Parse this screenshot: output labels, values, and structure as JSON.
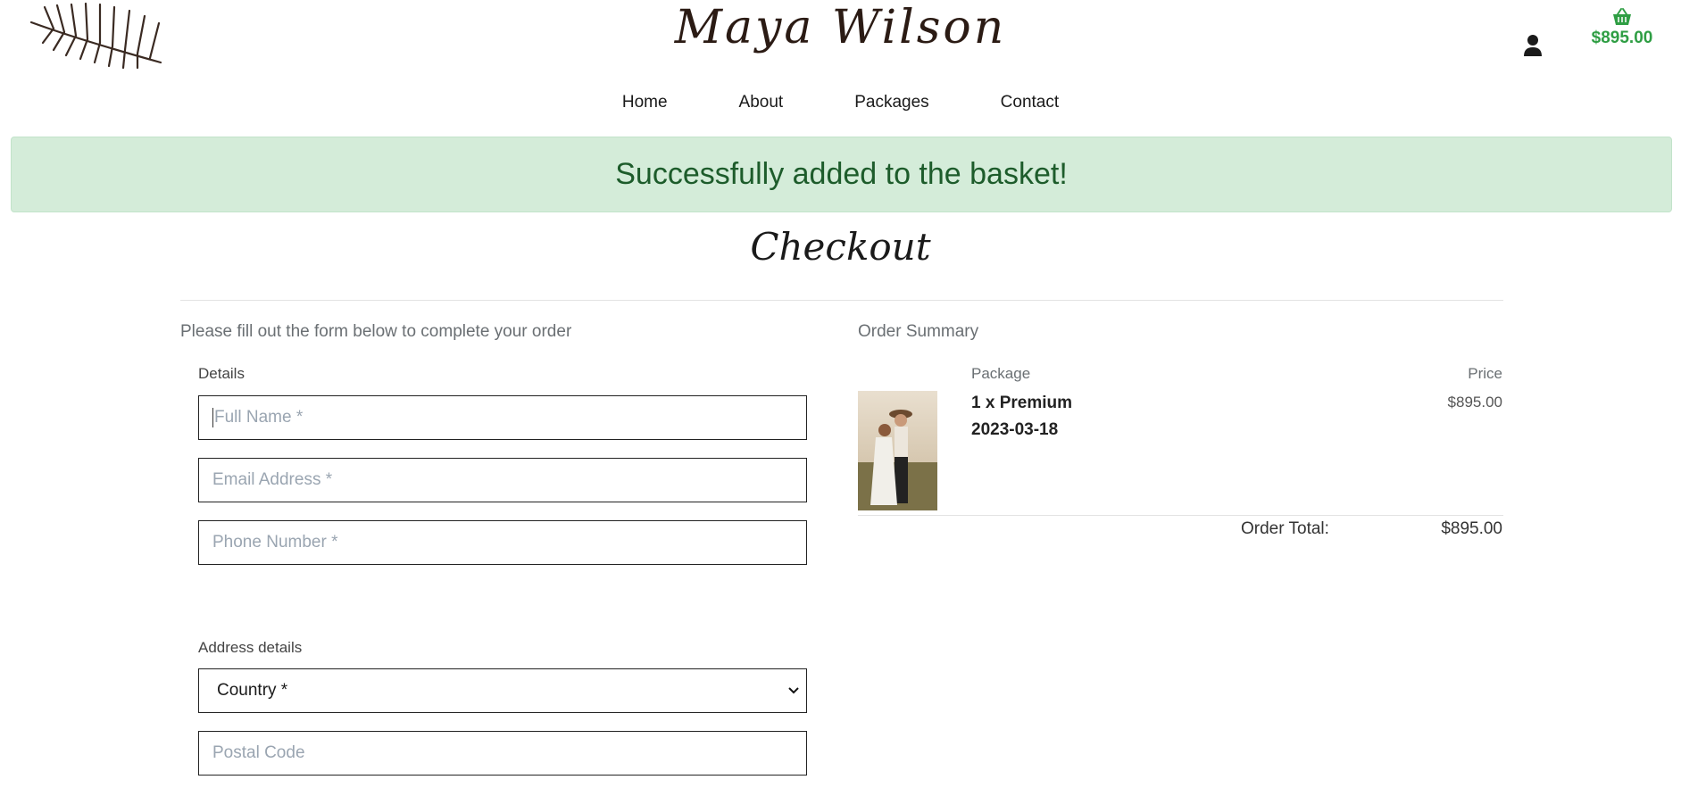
{
  "header": {
    "brand": "Maya Wilson",
    "basket_total": "$895.00"
  },
  "nav": {
    "items": [
      "Home",
      "About",
      "Packages",
      "Contact"
    ]
  },
  "alert": {
    "message": "Successfully added to the basket!"
  },
  "page": {
    "title": "Checkout"
  },
  "form": {
    "intro": "Please fill out the form below to complete your order",
    "details_label": "Details",
    "full_name_placeholder": "Full Name *",
    "email_placeholder": "Email Address *",
    "phone_placeholder": "Phone Number *",
    "address_label": "Address details",
    "country_selected": "Country *",
    "postal_placeholder": "Postal Code"
  },
  "summary": {
    "title": "Order Summary",
    "col_package": "Package",
    "col_price": "Price",
    "item_name": "1 x Premium",
    "item_date": "2023-03-18",
    "item_price": "$895.00",
    "total_label": "Order Total:",
    "total_value": "$895.00"
  },
  "colors": {
    "accent_green": "#2f9e44",
    "alert_bg": "#d4ecd9",
    "alert_text": "#1d5c2b"
  },
  "icons": [
    "leaf-logo-icon",
    "user-icon",
    "basket-icon",
    "chevron-down-icon"
  ]
}
